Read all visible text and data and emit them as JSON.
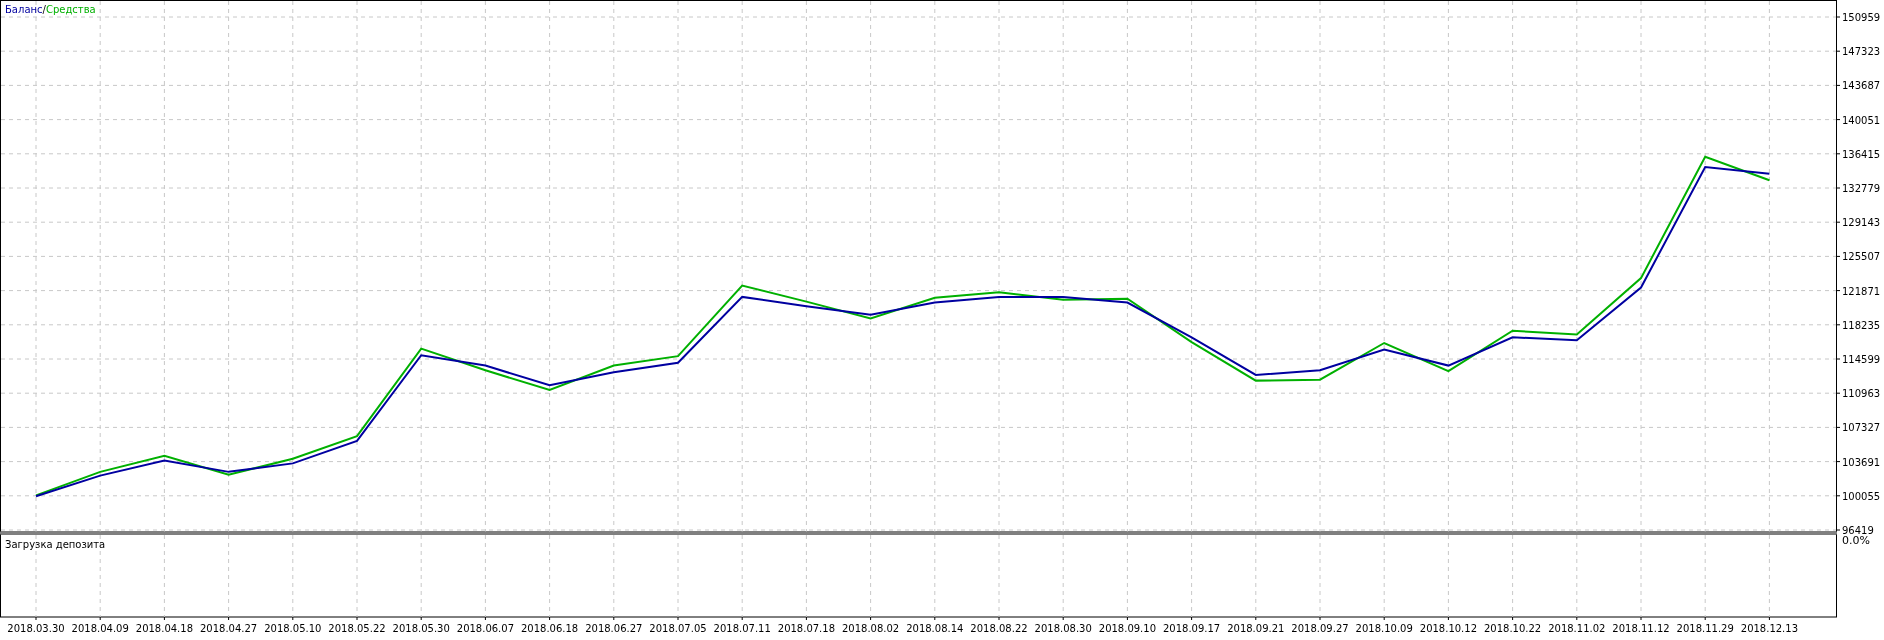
{
  "chart": {
    "legend_separator": "/",
    "chart_data": {
      "type": "line",
      "grid": true,
      "categories": [
        "2018.03.30",
        "2018.04.09",
        "2018.04.18",
        "2018.04.27",
        "2018.05.10",
        "2018.05.22",
        "2018.05.30",
        "2018.06.07",
        "2018.06.18",
        "2018.06.27",
        "2018.07.05",
        "2018.07.11",
        "2018.07.18",
        "2018.08.02",
        "2018.08.14",
        "2018.08.22",
        "2018.08.30",
        "2018.09.10",
        "2018.09.17",
        "2018.09.21",
        "2018.09.27",
        "2018.10.09",
        "2018.10.12",
        "2018.10.22",
        "2018.11.02",
        "2018.11.12",
        "2018.11.29",
        "2018.12.13"
      ],
      "ylim": [
        96419,
        150959
      ],
      "yticks": [
        96419,
        100055,
        103691,
        107327,
        110963,
        114599,
        118235,
        121871,
        125507,
        129143,
        132779,
        136415,
        140051,
        143687,
        147323,
        150959
      ],
      "series": [
        {
          "name": "Баланс",
          "color": "#0000a0",
          "values": [
            100000,
            102200,
            103800,
            102600,
            103500,
            105900,
            115000,
            113900,
            111800,
            113200,
            114200,
            121200,
            120200,
            119300,
            120600,
            121200,
            121200,
            120600,
            116900,
            112900,
            113400,
            115600,
            113900,
            116900,
            116600,
            122200,
            135000,
            134300
          ]
        },
        {
          "name": "Средства",
          "color": "#00b000",
          "values": [
            100100,
            102600,
            104300,
            102300,
            104000,
            106400,
            115700,
            113400,
            111300,
            113900,
            114900,
            122400,
            120700,
            118900,
            121100,
            121700,
            120900,
            121000,
            116400,
            112300,
            112400,
            116300,
            113300,
            117600,
            117200,
            123200,
            136100,
            133600
          ]
        }
      ]
    }
  },
  "indicator": {
    "title": "Загрузка депозита",
    "value": "0.0%"
  }
}
